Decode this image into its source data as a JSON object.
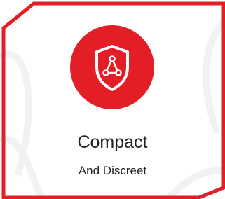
{
  "card": {
    "title": "Compact",
    "subtitle": "And Discreet",
    "icon": "shield-network-icon"
  },
  "colors": {
    "accent": "#e41e26",
    "background": "#ffffff",
    "text": "#222222",
    "watermark": "#f3f3f3"
  }
}
